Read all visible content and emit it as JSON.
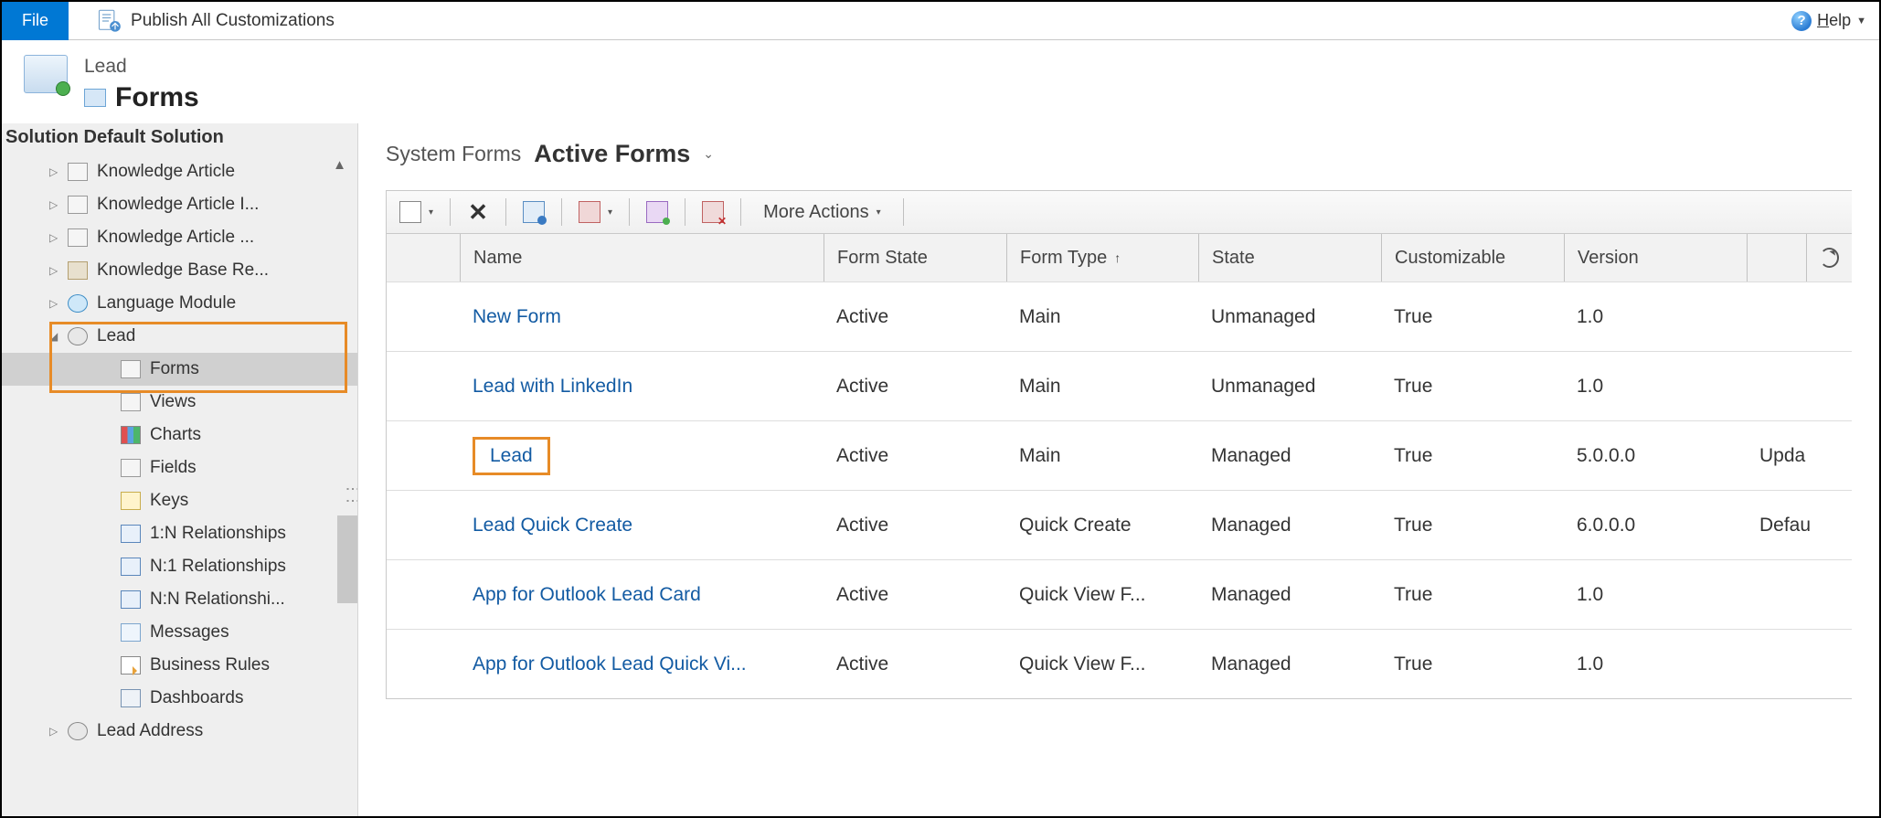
{
  "ribbon": {
    "file": "File",
    "publish": "Publish All Customizations",
    "help": "Help"
  },
  "header": {
    "entity": "Lead",
    "title": "Forms"
  },
  "sidebar": {
    "solution_label": "Solution Default Solution",
    "items_top": [
      {
        "label": "Knowledge Article"
      },
      {
        "label": "Knowledge Article I..."
      },
      {
        "label": "Knowledge Article ..."
      },
      {
        "label": "Knowledge Base Re..."
      },
      {
        "label": "Language Module"
      }
    ],
    "lead_label": "Lead",
    "lead_children": [
      {
        "label": "Forms",
        "selected": true
      },
      {
        "label": "Views"
      },
      {
        "label": "Charts"
      },
      {
        "label": "Fields"
      },
      {
        "label": "Keys"
      },
      {
        "label": "1:N Relationships"
      },
      {
        "label": "N:1 Relationships"
      },
      {
        "label": "N:N Relationshi..."
      },
      {
        "label": "Messages"
      },
      {
        "label": "Business Rules"
      },
      {
        "label": "Dashboards"
      }
    ],
    "lead_address_label": "Lead Address"
  },
  "main": {
    "view_category": "System Forms",
    "view_name": "Active Forms",
    "more_actions": "More Actions",
    "columns": {
      "name": "Name",
      "form_state": "Form State",
      "form_type": "Form Type",
      "state": "State",
      "customizable": "Customizable",
      "version": "Version"
    },
    "rows": [
      {
        "name": "New Form",
        "form_state": "Active",
        "form_type": "Main",
        "state": "Unmanaged",
        "customizable": "True",
        "version": "1.0",
        "desc": ""
      },
      {
        "name": "Lead with LinkedIn",
        "form_state": "Active",
        "form_type": "Main",
        "state": "Unmanaged",
        "customizable": "True",
        "version": "1.0",
        "desc": ""
      },
      {
        "name": "Lead",
        "form_state": "Active",
        "form_type": "Main",
        "state": "Managed",
        "customizable": "True",
        "version": "5.0.0.0",
        "desc": "Upda",
        "highlight": true
      },
      {
        "name": "Lead Quick Create",
        "form_state": "Active",
        "form_type": "Quick Create",
        "state": "Managed",
        "customizable": "True",
        "version": "6.0.0.0",
        "desc": "Defau"
      },
      {
        "name": "App for Outlook Lead Card",
        "form_state": "Active",
        "form_type": "Quick View F...",
        "state": "Managed",
        "customizable": "True",
        "version": "1.0",
        "desc": ""
      },
      {
        "name": "App for Outlook Lead Quick Vi...",
        "form_state": "Active",
        "form_type": "Quick View F...",
        "state": "Managed",
        "customizable": "True",
        "version": "1.0",
        "desc": ""
      }
    ]
  }
}
